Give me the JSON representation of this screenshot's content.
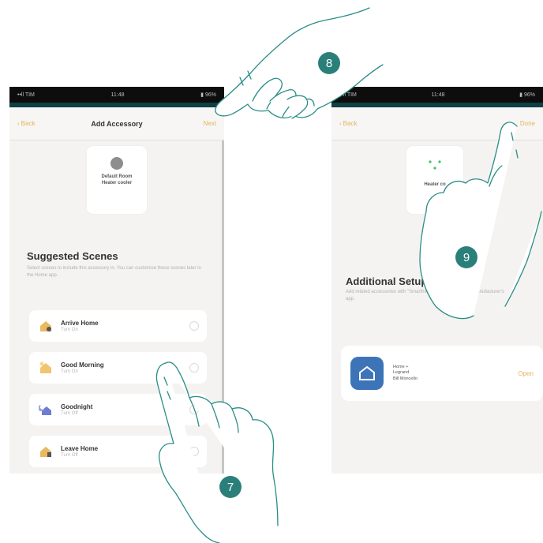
{
  "left_screen": {
    "status": {
      "carrier": "••ll TIM",
      "time": "11:48",
      "battery": "▮ 96%"
    },
    "nav": {
      "back": "Back",
      "title": "Add Accessory",
      "next": "Next"
    },
    "accessory": {
      "label": "Default Room\nHeater cooler"
    },
    "section_title": "Suggested Scenes",
    "section_desc": "Select scenes to include this accessory in. You can customise these scenes later in the Home app.",
    "scenes": [
      {
        "name": "Arrive Home",
        "sub": "Turn On",
        "icon": "arrive-home-icon",
        "color": "#e9b960"
      },
      {
        "name": "Good Morning",
        "sub": "Turn On",
        "icon": "good-morning-icon",
        "color": "#f1c46f"
      },
      {
        "name": "Goodnight",
        "sub": "Turn Off",
        "icon": "goodnight-icon",
        "color": "#6d7ed0"
      },
      {
        "name": "Leave Home",
        "sub": "Turn Off",
        "icon": "leave-home-icon",
        "color": "#e9b960"
      }
    ]
  },
  "right_screen": {
    "status": {
      "carrier": "••ll TIM",
      "time": "11:48",
      "battery": "▮ 96%"
    },
    "nav": {
      "back": "Back",
      "done": "Done"
    },
    "accessory": {
      "label": "Heater co"
    },
    "section_title": "Additional Setup Required",
    "section_desc": "Add related accessories with \"Smarther\" \"Thermostat\" in the manufacturer's app.",
    "app": {
      "line1": "Home +",
      "line2": "Legrand",
      "line3": "Bill Moncello",
      "action": "Open",
      "icon": "home-app-icon"
    }
  },
  "badges": {
    "b7": "7",
    "b8": "8",
    "b9": "9"
  },
  "colors": {
    "accent": "#e6b35b",
    "badge": "#2b7f7a",
    "hand_outline": "#2a8d87"
  }
}
